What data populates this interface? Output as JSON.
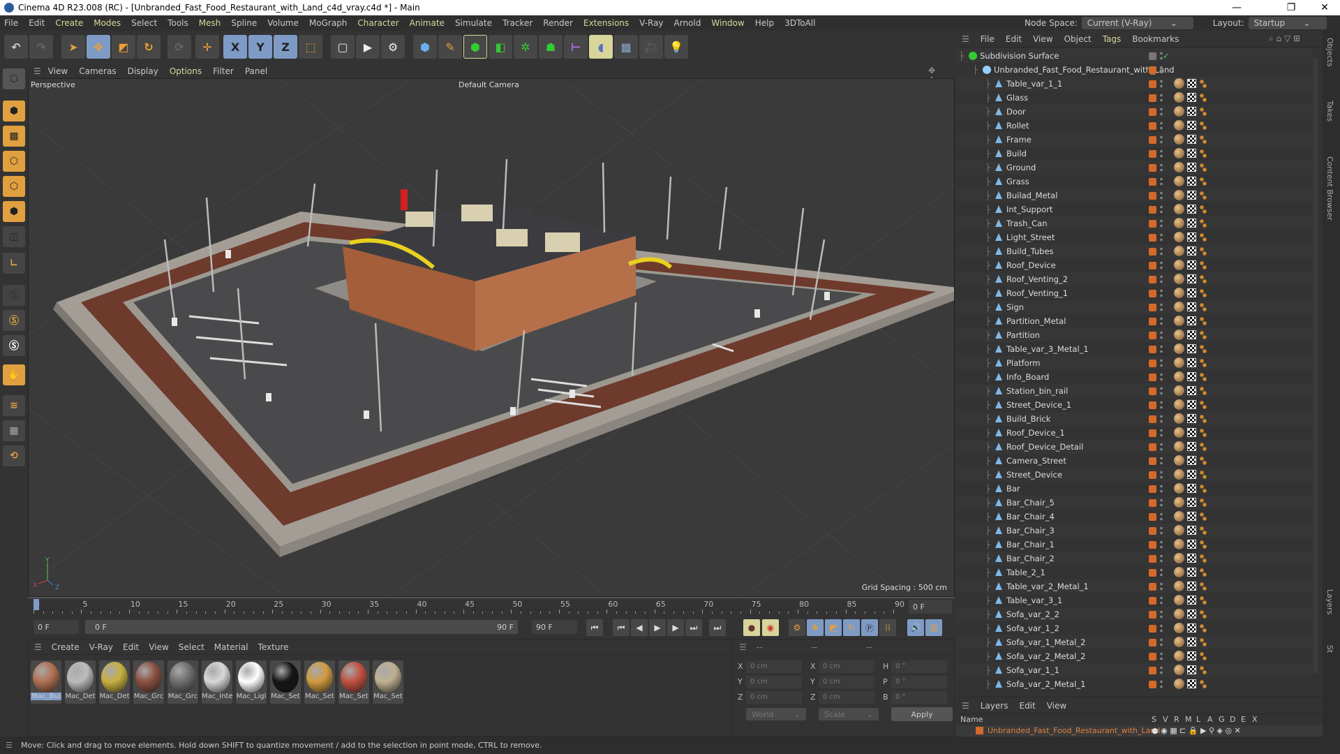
{
  "window": {
    "title": "Cinema 4D R23.008 (RC) - [Unbranded_Fast_Food_Restaurant_with_Land_c4d_vray.c4d *] - Main",
    "minimize": "—",
    "restore": "❐",
    "close": "✕"
  },
  "menu": [
    {
      "label": "File"
    },
    {
      "label": "Edit"
    },
    {
      "label": "Create",
      "hl": true
    },
    {
      "label": "Modes",
      "hl": true
    },
    {
      "label": "Select"
    },
    {
      "label": "Tools"
    },
    {
      "label": "Mesh",
      "hl": true
    },
    {
      "label": "Spline"
    },
    {
      "label": "Volume"
    },
    {
      "label": "MoGraph"
    },
    {
      "label": "Character",
      "hl": true
    },
    {
      "label": "Animate",
      "hl": true
    },
    {
      "label": "Simulate"
    },
    {
      "label": "Tracker"
    },
    {
      "label": "Render"
    },
    {
      "label": "Extensions",
      "hl": true
    },
    {
      "label": "V-Ray"
    },
    {
      "label": "Arnold"
    },
    {
      "label": "Window",
      "hl": true
    },
    {
      "label": "Help"
    },
    {
      "label": "3DToAll"
    }
  ],
  "nodespace": {
    "label": "Node Space:",
    "value": "Current (V-Ray)",
    "layout_label": "Layout:",
    "layout_value": "Startup"
  },
  "toolbar": {
    "x": "X",
    "y": "Y",
    "z": "Z"
  },
  "viewport": {
    "menu": [
      "View",
      "Cameras",
      "Display",
      "Options",
      "Filter",
      "Panel"
    ],
    "view_name": "Perspective",
    "camera": "Default Camera",
    "grid_spacing": "Grid Spacing : 500 cm",
    "axis": {
      "x": "X",
      "y": "Y",
      "z": "Z"
    }
  },
  "timeline": {
    "ticks": [
      0,
      5,
      10,
      15,
      20,
      25,
      30,
      35,
      40,
      45,
      50,
      55,
      60,
      65,
      70,
      75,
      80,
      85,
      90
    ],
    "current_frame": "0 F",
    "start": "0 F",
    "range_start": "0 F",
    "range_end": "90 F",
    "end": "90 F"
  },
  "materials": {
    "menu": [
      "Create",
      "V-Ray",
      "Edit",
      "View",
      "Select",
      "Material",
      "Texture"
    ],
    "items": [
      {
        "label": "Mac_Bui",
        "color": "#b07050"
      },
      {
        "label": "Mac_Det",
        "color": "#bbbbbb"
      },
      {
        "label": "Mac_Det",
        "color": "#c8b040"
      },
      {
        "label": "Mac_Grc",
        "color": "#8a5040"
      },
      {
        "label": "Mac_Grc",
        "color": "#6e6e6e"
      },
      {
        "label": "Mac_Inte",
        "color": "#d8d8d8"
      },
      {
        "label": "Mac_Ligl",
        "color": "#ffffff"
      },
      {
        "label": "Mac_Set",
        "color": "#151515"
      },
      {
        "label": "Mac_Set",
        "color": "#d09a40"
      },
      {
        "label": "Mac_Set",
        "color": "#c05040"
      },
      {
        "label": "Mac_Set",
        "color": "#c0b090"
      }
    ]
  },
  "coords": {
    "headers": [
      "--",
      "--",
      "--"
    ],
    "rows": [
      {
        "a": "X",
        "av": "0 cm",
        "b": "X",
        "bv": "0 cm",
        "c": "H",
        "cv": "0 °"
      },
      {
        "a": "Y",
        "av": "0 cm",
        "b": "Y",
        "bv": "0 cm",
        "c": "P",
        "cv": "0 °"
      },
      {
        "a": "Z",
        "av": "0 cm",
        "b": "Z",
        "bv": "0 cm",
        "c": "B",
        "cv": "0 °"
      }
    ],
    "mode": "World",
    "type": "Scale",
    "apply": "Apply"
  },
  "objects": {
    "menu": [
      {
        "label": "File"
      },
      {
        "label": "Edit"
      },
      {
        "label": "View"
      },
      {
        "label": "Object"
      },
      {
        "label": "Tags",
        "hl": true
      },
      {
        "label": "Bookmarks"
      }
    ],
    "root": "Subdivision Surface",
    "group": "Unbranded_Fast_Food_Restaurant_with_Land",
    "items": [
      "Table_var_1_1",
      "Glass",
      "Door",
      "Rollet",
      "Frame",
      "Build",
      "Ground",
      "Grass",
      "Builad_Metal",
      "Int_Support",
      "Trash_Can",
      "Light_Street",
      "Build_Tubes",
      "Roof_Device",
      "Roof_Venting_2",
      "Roof_Venting_1",
      "Sign",
      "Partition_Metal",
      "Partition",
      "Table_var_3_Metal_1",
      "Platform",
      "Info_Board",
      "Station_bin_rail",
      "Street_Device_1",
      "Build_Brick",
      "Roof_Device_1",
      "Roof_Device_Detail",
      "Camera_Street",
      "Street_Device",
      "Bar",
      "Bar_Chair_5",
      "Bar_Chair_4",
      "Bar_Chair_3",
      "Bar_Chair_1",
      "Bar_Chair_2",
      "Table_2_1",
      "Table_var_2_Metal_1",
      "Table_var_3_1",
      "Sofa_var_2_2",
      "Sofa_var_1_2",
      "Sofa_var_1_Metal_2",
      "Sofa_var_2_Metal_2",
      "Sofa_var_1_1",
      "Sofa_var_2_Metal_1"
    ]
  },
  "sidetabs": [
    "Objects",
    "Takes",
    "Content Browser",
    "Layers",
    "St"
  ],
  "layers": {
    "menu": [
      "Layers",
      "Edit",
      "View"
    ],
    "name_col": "Name",
    "cols": [
      "S",
      "V",
      "R",
      "M",
      "L",
      "A",
      "G",
      "D",
      "E",
      "X"
    ],
    "layer": "Unbranded_Fast_Food_Restaurant_with_Land",
    "layer_color": "#d4692a"
  },
  "status": "Move: Click and drag to move elements. Hold down SHIFT to quantize movement / add to the selection in point mode, CTRL to remove."
}
